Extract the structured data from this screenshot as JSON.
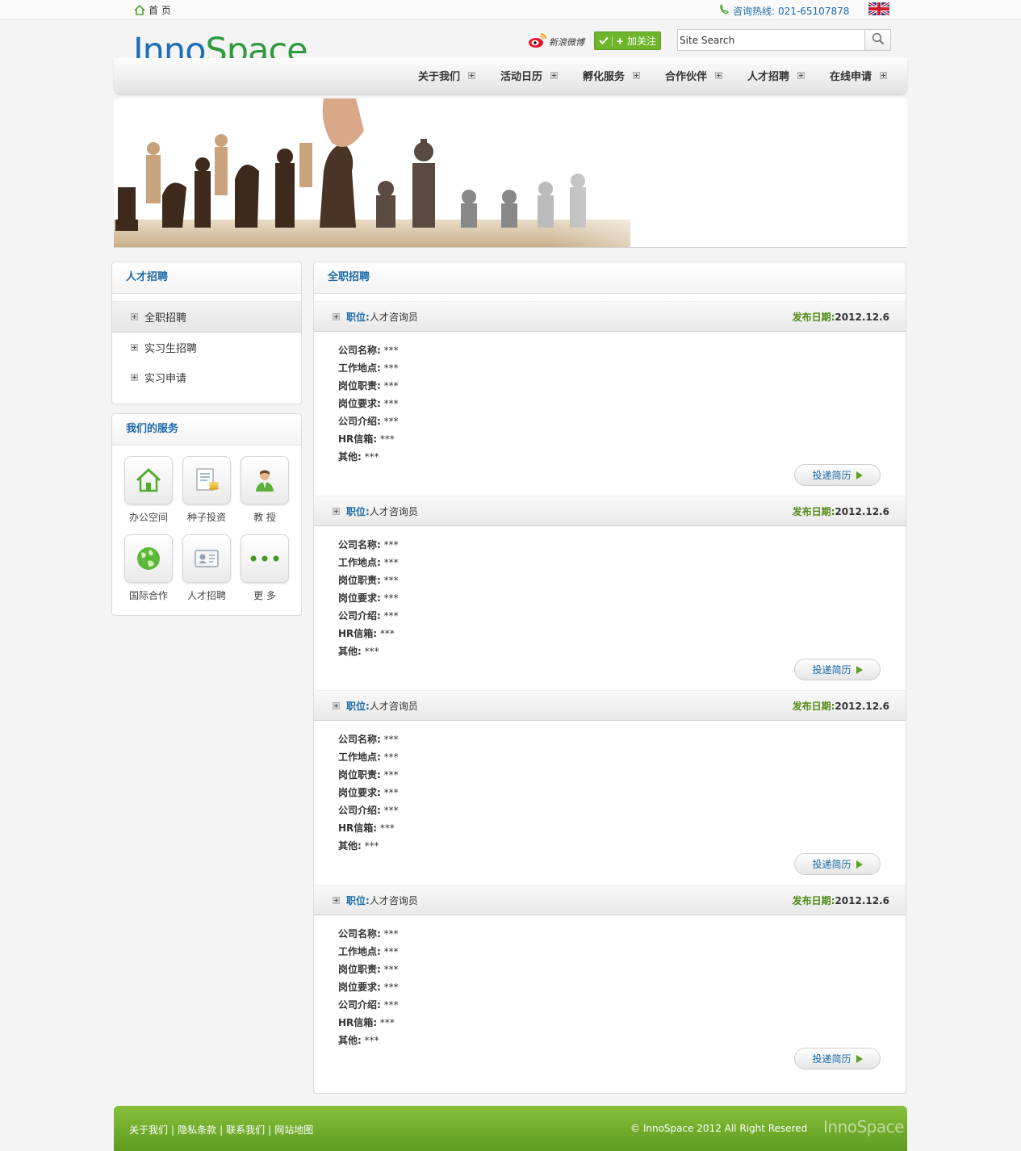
{
  "topbar": {
    "home_label": "首 页",
    "hotline_label": "咨询热线:",
    "hotline_number": "021-65107878"
  },
  "header": {
    "logo_part1": "Inno",
    "logo_part2": "Space",
    "weibo_label": "新浪微博",
    "follow_label": "加关注",
    "search_value": "Site Search"
  },
  "nav": {
    "items": [
      {
        "label": "关于我们"
      },
      {
        "label": "活动日历"
      },
      {
        "label": "孵化服务"
      },
      {
        "label": "合作伙伴"
      },
      {
        "label": "人才招聘"
      },
      {
        "label": "在线申请"
      }
    ]
  },
  "sidebar": {
    "title": "人才招聘",
    "items": [
      {
        "label": "全职招聘"
      },
      {
        "label": "实习生招聘"
      },
      {
        "label": "实习申请"
      }
    ]
  },
  "services": {
    "title": "我们的服务",
    "items": [
      {
        "label": "办公空间",
        "icon": "house-icon"
      },
      {
        "label": "种子投资",
        "icon": "document-coins-icon"
      },
      {
        "label": "教 授",
        "icon": "person-icon"
      },
      {
        "label": "国际合作",
        "icon": "globe-icon"
      },
      {
        "label": "人才招聘",
        "icon": "id-card-icon"
      },
      {
        "label": "更 多",
        "icon": "more-dots-icon"
      }
    ]
  },
  "main": {
    "title": "全职招聘",
    "position_label": "职位:",
    "date_label": "发布日期:",
    "apply_label": "投递简历",
    "jobs": [
      {
        "position": "人才咨询员",
        "date": "2012.12.6",
        "fields": [
          {
            "k": "公司名称:",
            "v": "***"
          },
          {
            "k": "工作地点:",
            "v": "***"
          },
          {
            "k": "岗位职责:",
            "v": "***"
          },
          {
            "k": "岗位要求:",
            "v": "***"
          },
          {
            "k": "公司介绍:",
            "v": "***"
          },
          {
            "k": "HR信箱:",
            "v": "***"
          },
          {
            "k": "其他:",
            "v": "***"
          }
        ]
      },
      {
        "position": "人才咨询员",
        "date": "2012.12.6",
        "fields": [
          {
            "k": "公司名称:",
            "v": "***"
          },
          {
            "k": "工作地点:",
            "v": "***"
          },
          {
            "k": "岗位职责:",
            "v": "***"
          },
          {
            "k": "岗位要求:",
            "v": "***"
          },
          {
            "k": "公司介绍:",
            "v": "***"
          },
          {
            "k": "HR信箱:",
            "v": "***"
          },
          {
            "k": "其他:",
            "v": "***"
          }
        ]
      },
      {
        "position": "人才咨询员",
        "date": "2012.12.6",
        "fields": [
          {
            "k": "公司名称:",
            "v": "***"
          },
          {
            "k": "工作地点:",
            "v": "***"
          },
          {
            "k": "岗位职责:",
            "v": "***"
          },
          {
            "k": "岗位要求:",
            "v": "***"
          },
          {
            "k": "公司介绍:",
            "v": "***"
          },
          {
            "k": "HR信箱:",
            "v": "***"
          },
          {
            "k": "其他:",
            "v": "***"
          }
        ]
      },
      {
        "position": "人才咨询员",
        "date": "2012.12.6",
        "fields": [
          {
            "k": "公司名称:",
            "v": "***"
          },
          {
            "k": "工作地点:",
            "v": "***"
          },
          {
            "k": "岗位职责:",
            "v": "***"
          },
          {
            "k": "岗位要求:",
            "v": "***"
          },
          {
            "k": "公司介绍:",
            "v": "***"
          },
          {
            "k": "HR信箱:",
            "v": "***"
          },
          {
            "k": "其他:",
            "v": "***"
          }
        ]
      }
    ]
  },
  "footer": {
    "links": [
      {
        "label": "关于我们"
      },
      {
        "label": "隐私条款"
      },
      {
        "label": "联系我们"
      },
      {
        "label": "网站地图"
      }
    ],
    "copyright": "© InnoSpace 2012 All Right Resered",
    "logo": "InnoSpace"
  },
  "colors": {
    "brand_blue": "#1f6db5",
    "brand_green": "#2e9b3c",
    "footer_green": "#6fae2a",
    "accent_green": "#6fb52c"
  }
}
